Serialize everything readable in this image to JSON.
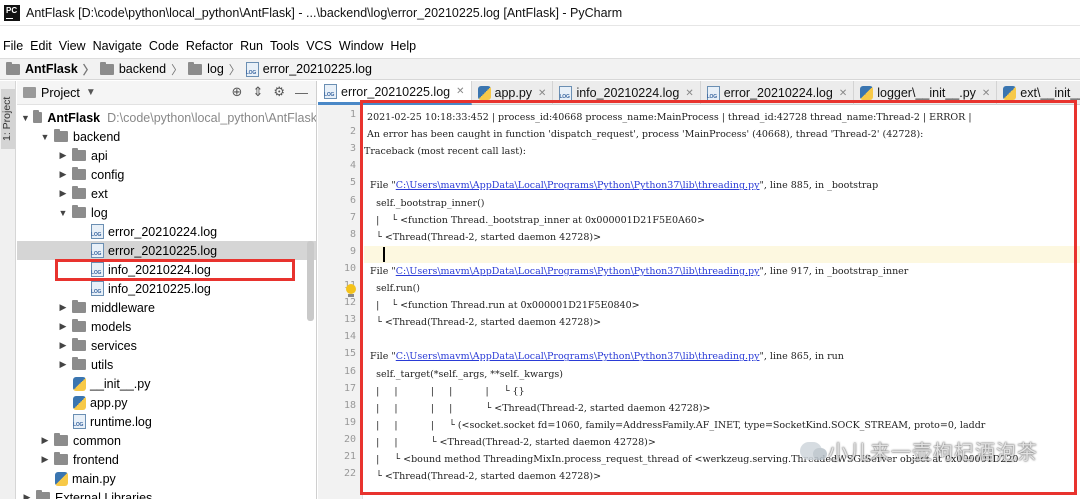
{
  "window": {
    "title": "AntFlask [D:\\code\\python\\local_python\\AntFlask] - ...\\backend\\log\\error_20210225.log [AntFlask] - PyCharm",
    "app_icon_text": "PC"
  },
  "menu": [
    "File",
    "Edit",
    "View",
    "Navigate",
    "Code",
    "Refactor",
    "Run",
    "Tools",
    "VCS",
    "Window",
    "Help"
  ],
  "breadcrumb": [
    "AntFlask",
    "backend",
    "log",
    "error_20210225.log"
  ],
  "side_strip": {
    "label": "1: Project"
  },
  "project_panel": {
    "title": "Project",
    "rows": [
      {
        "label": "AntFlask",
        "extra": "D:\\code\\python\\local_python\\AntFlask"
      },
      {
        "label": "backend"
      },
      {
        "label": "api"
      },
      {
        "label": "config"
      },
      {
        "label": "ext"
      },
      {
        "label": "log"
      },
      {
        "label": "error_20210224.log"
      },
      {
        "label": "error_20210225.log"
      },
      {
        "label": "info_20210224.log"
      },
      {
        "label": "info_20210225.log"
      },
      {
        "label": "middleware"
      },
      {
        "label": "models"
      },
      {
        "label": "services"
      },
      {
        "label": "utils"
      },
      {
        "label": "__init__.py"
      },
      {
        "label": "app.py"
      },
      {
        "label": "runtime.log"
      },
      {
        "label": "common"
      },
      {
        "label": "frontend"
      },
      {
        "label": "main.py"
      },
      {
        "label": "External Libraries"
      }
    ]
  },
  "tabs": [
    {
      "label": "error_20210225.log",
      "type": "log",
      "active": true
    },
    {
      "label": "app.py",
      "type": "py"
    },
    {
      "label": "info_20210224.log",
      "type": "log"
    },
    {
      "label": "error_20210224.log",
      "type": "log"
    },
    {
      "label": "logger\\__init__.py",
      "type": "py"
    },
    {
      "label": "ext\\__init__.py",
      "type": "py"
    }
  ],
  "code": {
    "line_numbers": [
      "1",
      "2",
      "3",
      "4",
      "5",
      "6",
      "7",
      "8",
      "9",
      "10",
      "11",
      "12",
      "13",
      "14",
      "15",
      "16",
      "17",
      "18",
      "19",
      "20",
      "21",
      "22"
    ],
    "lines": [
      {
        "text": " 2021-02-25 10:18:33:452 | process_id:40668 process_name:MainProcess | thread_id:42728 thread_name:Thread-2 | ERROR |"
      },
      {
        "text": " An error has been caught in function 'dispatch_request', process 'MainProcess' (40668), thread 'Thread-2' (42728):"
      },
      {
        "text": "Traceback (most recent call last):"
      },
      {
        "text": ""
      },
      {
        "pre": "  File \"",
        "link": "C:\\Users\\mavm\\AppData\\Local\\Programs\\Python\\Python37\\lib\\threading.py",
        "post": "\", line 885, in _bootstrap"
      },
      {
        "text": "    self._bootstrap_inner()"
      },
      {
        "text": "    |    └ <function Thread._bootstrap_inner at 0x000001D21F5E0A60>"
      },
      {
        "text": "    └ <Thread(Thread-2, started daemon 42728)>"
      },
      {
        "text": ""
      },
      {
        "pre": "  File \"",
        "link": "C:\\Users\\mavm\\AppData\\Local\\Programs\\Python\\Python37\\lib\\threading.py",
        "post": "\", line 917, in _bootstrap_inner"
      },
      {
        "text": "    self.run()"
      },
      {
        "text": "    |    └ <function Thread.run at 0x000001D21F5E0840>"
      },
      {
        "text": "    └ <Thread(Thread-2, started daemon 42728)>"
      },
      {
        "text": ""
      },
      {
        "pre": "  File \"",
        "link": "C:\\Users\\mavm\\AppData\\Local\\Programs\\Python\\Python37\\lib\\threading.py",
        "post": "\", line 865, in run"
      },
      {
        "text": "    self._target(*self._args, **self._kwargs)"
      },
      {
        "text": "    |     |           |     |           |     └ {}"
      },
      {
        "text": "    |     |           |     |           └ <Thread(Thread-2, started daemon 42728)>"
      },
      {
        "text": "    |     |           |     └ (<socket.socket fd=1060, family=AddressFamily.AF_INET, type=SocketKind.SOCK_STREAM, proto=0, laddr"
      },
      {
        "text": "    |     |           └ <Thread(Thread-2, started daemon 42728)>"
      },
      {
        "text": "    |     └ <bound method ThreadingMixIn.process_request_thread of <werkzeug.serving.ThreadedWSGIServer object at 0x000001D220"
      },
      {
        "text": "    └ <Thread(Thread-2, started daemon 42728)>"
      }
    ]
  },
  "watermark": {
    "text": "小儿来一壶枸杞酒泡茶"
  },
  "colors": {
    "highlight": "#e8332e",
    "link": "#2a3bd6",
    "selected_row": "#d5d5d5"
  }
}
